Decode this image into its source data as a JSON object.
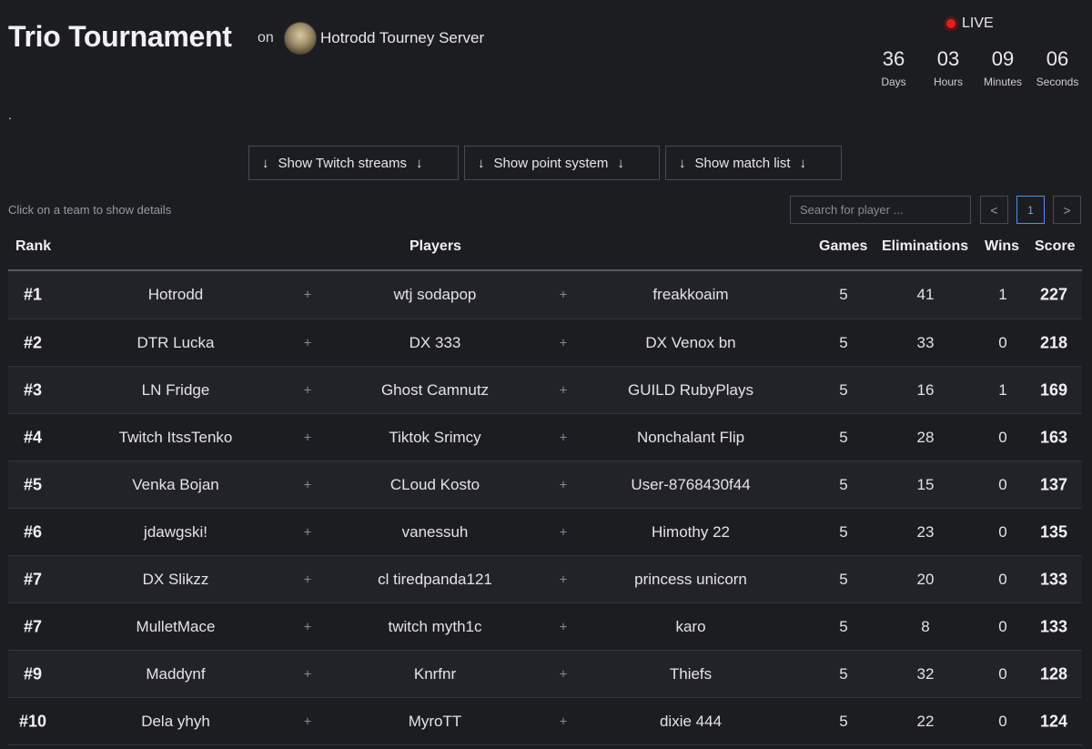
{
  "header": {
    "title": "Trio Tournament",
    "on_label": "on",
    "server_name": "Hotrodd Tourney Server",
    "live_label": "LIVE",
    "countdown": [
      {
        "value": "36",
        "unit": "Days"
      },
      {
        "value": "03",
        "unit": "Hours"
      },
      {
        "value": "09",
        "unit": "Minutes"
      },
      {
        "value": "06",
        "unit": "Seconds"
      }
    ],
    "description": "."
  },
  "toggles": [
    {
      "label": "Show Twitch streams"
    },
    {
      "label": "Show point system"
    },
    {
      "label": "Show match list"
    }
  ],
  "hint": "Click on a team to show details",
  "search": {
    "placeholder": "Search for player ..."
  },
  "pager": {
    "prev": "<",
    "current": "1",
    "next": ">"
  },
  "columns": {
    "rank": "Rank",
    "players": "Players",
    "games": "Games",
    "eliminations": "Eliminations",
    "wins": "Wins",
    "score": "Score"
  },
  "rows": [
    {
      "rank": "#1",
      "p1": "Hotrodd",
      "p2": "wtj sodapop",
      "p3": "freakkoaim",
      "games": "5",
      "elims": "41",
      "wins": "1",
      "score": "227"
    },
    {
      "rank": "#2",
      "p1": "DTR Lucka",
      "p2": "DX 333",
      "p3": "DX Venox bn",
      "games": "5",
      "elims": "33",
      "wins": "0",
      "score": "218"
    },
    {
      "rank": "#3",
      "p1": "LN Fridge",
      "p2": "Ghost Camnutz",
      "p3": "GUILD RubyPlays",
      "games": "5",
      "elims": "16",
      "wins": "1",
      "score": "169"
    },
    {
      "rank": "#4",
      "p1": "Twitch ItssTenko",
      "p2": "Tiktok Srimcy",
      "p3": "Nonchalant Flip",
      "games": "5",
      "elims": "28",
      "wins": "0",
      "score": "163"
    },
    {
      "rank": "#5",
      "p1": "Venka Bojan",
      "p2": "CLoud Kosto",
      "p3": "User-8768430f44",
      "games": "5",
      "elims": "15",
      "wins": "0",
      "score": "137"
    },
    {
      "rank": "#6",
      "p1": "jdawgski!",
      "p2": "vanessuh",
      "p3": "Himothy 22",
      "games": "5",
      "elims": "23",
      "wins": "0",
      "score": "135"
    },
    {
      "rank": "#7",
      "p1": "DX Slikzz",
      "p2": "cl tiredpanda121",
      "p3": "princess unicorn",
      "games": "5",
      "elims": "20",
      "wins": "0",
      "score": "133"
    },
    {
      "rank": "#7",
      "p1": "MulletMace",
      "p2": "twitch myth1c",
      "p3": "karo",
      "games": "5",
      "elims": "8",
      "wins": "0",
      "score": "133"
    },
    {
      "rank": "#9",
      "p1": "Maddynf",
      "p2": "Knrfnr",
      "p3": "Thiefs",
      "games": "5",
      "elims": "32",
      "wins": "0",
      "score": "128"
    },
    {
      "rank": "#10",
      "p1": "Dela yhyh",
      "p2": "MyroTT",
      "p3": "dixie 444",
      "games": "5",
      "elims": "22",
      "wins": "0",
      "score": "124"
    }
  ],
  "plus_symbol": "+",
  "colors": {
    "background": "#1c1d21",
    "live": "#e0201f",
    "accent": "#4f8fe0"
  }
}
